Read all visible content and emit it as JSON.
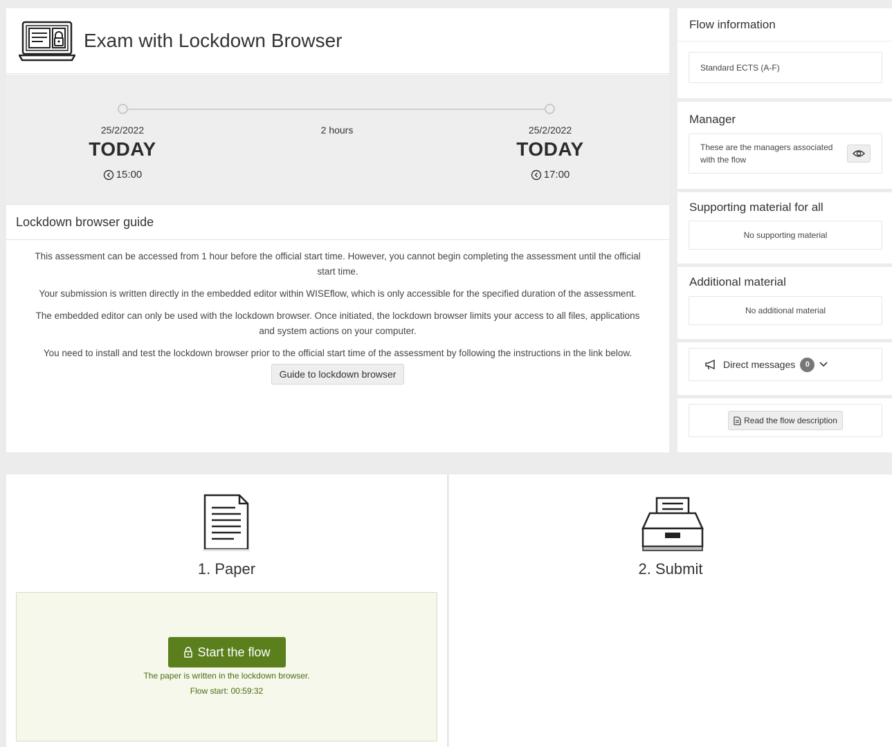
{
  "header": {
    "title": "Exam with Lockdown Browser"
  },
  "timeline": {
    "start_date": "25/2/2022",
    "start_day": "TODAY",
    "start_time": "15:00",
    "duration": "2 hours",
    "end_date": "25/2/2022",
    "end_day": "TODAY",
    "end_time": "17:00"
  },
  "guide": {
    "title": "Lockdown browser guide",
    "p1": "This assessment can be accessed from 1 hour before the official start time. However, you cannot begin completing the assessment until the official start time.",
    "p2": "Your submission is written directly in the embedded editor within WISEflow, which is only accessible for the specified duration of the assessment.",
    "p3": "The embedded editor can only be used with the lockdown browser. Once initiated, the lockdown browser limits your access to all files, applications and system actions on your computer.",
    "p4": "You need to install and test the lockdown browser prior to the official start time of the assessment by following the instructions in the link below.",
    "button": "Guide to lockdown browser"
  },
  "sidebar": {
    "flow_info_title": "Flow information",
    "grading_scale": "Standard ECTS (A-F)",
    "manager_title": "Manager",
    "manager_text": "These are the managers associated with the flow",
    "supporting_title": "Supporting material for all",
    "supporting_text": "No supporting material",
    "additional_title": "Additional material",
    "additional_text": "No additional material",
    "direct_messages": "Direct messages",
    "direct_count": "0",
    "read_description": "Read the flow description"
  },
  "steps": {
    "paper_label": "1. Paper",
    "submit_label": "2. Submit",
    "start_button": "Start the flow",
    "note": "The paper is written in the lockdown browser.",
    "flow_start": "Flow start: 00:59:32"
  },
  "colors": {
    "accent_green": "#5a7f1c",
    "green_box": "#f5f8ea",
    "panel_gray": "#eeeeee"
  }
}
